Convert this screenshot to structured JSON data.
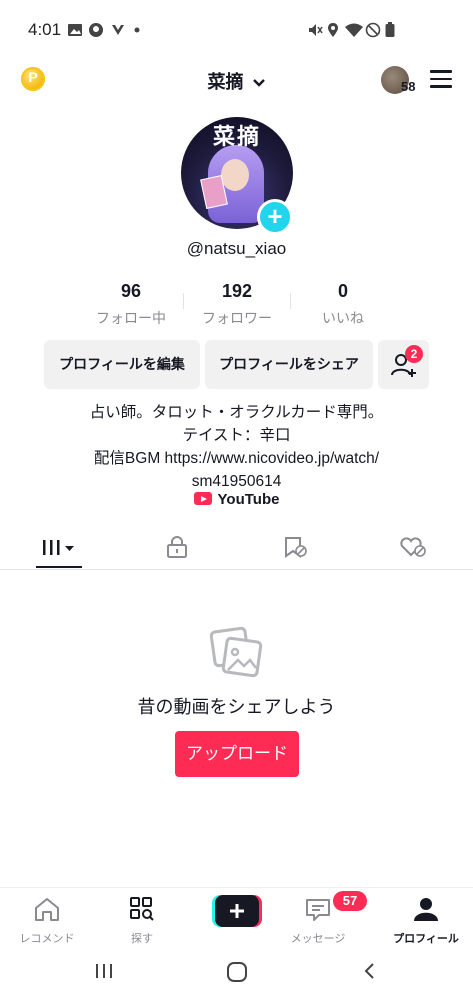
{
  "status_bar": {
    "time": "4:01"
  },
  "header": {
    "coin_label": "P",
    "username": "菜摘",
    "inbox_count": "58"
  },
  "profile": {
    "avatar_text": "菜摘",
    "handle": "@natsu_xiao",
    "stats": [
      {
        "value": "96",
        "label": "フォロー中"
      },
      {
        "value": "192",
        "label": "フォロワー"
      },
      {
        "value": "0",
        "label": "いいね"
      }
    ],
    "edit_button": "プロフィールを編集",
    "share_button": "プロフィールをシェア",
    "add_friend_badge": "2",
    "bio_lines": [
      "占い師。タロット・オラクルカード専門。",
      "テイスト：辛口",
      "配信BGM https://www.nicovideo.jp/watch/",
      "sm41950614"
    ],
    "youtube_link": "YouTube"
  },
  "empty_state": {
    "title": "昔の動画をシェアしよう",
    "upload_button": "アップロード"
  },
  "bottom_nav": {
    "items": [
      {
        "label": "レコメンド"
      },
      {
        "label": "探す"
      },
      {
        "label": ""
      },
      {
        "label": "メッセージ"
      },
      {
        "label": "プロフィール"
      }
    ],
    "message_badge": "57"
  },
  "colors": {
    "accent": "#fe2c55",
    "plus_badge": "#20d5ec",
    "text": "#161823",
    "muted": "#8a8b91"
  }
}
